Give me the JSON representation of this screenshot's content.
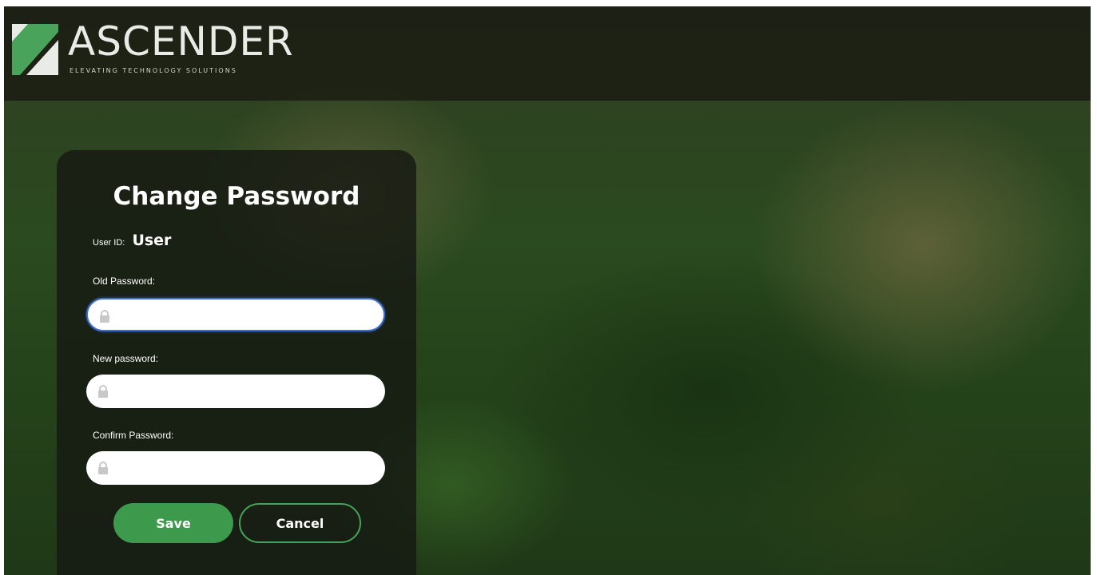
{
  "header": {
    "brand_name": "ASCENDER",
    "tagline": "ELEVATING TECHNOLOGY SOLUTIONS",
    "logo_icon": "ascender-logo-icon"
  },
  "form": {
    "title": "Change Password",
    "user_id_label": "User ID:",
    "user_id_value": "User",
    "old_password": {
      "label": "Old Password:",
      "value": "",
      "placeholder": ""
    },
    "new_password": {
      "label": "New password:",
      "value": "",
      "placeholder": ""
    },
    "confirm_password": {
      "label": "Confirm Password:",
      "value": "",
      "placeholder": ""
    },
    "save_label": "Save",
    "cancel_label": "Cancel"
  },
  "colors": {
    "accent_green": "#3d9a4d",
    "focus_blue": "#3f6fd1",
    "panel_bg": "#16181299"
  }
}
